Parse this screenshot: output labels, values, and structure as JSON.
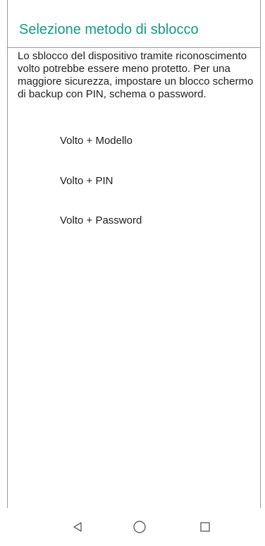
{
  "dialog": {
    "title": "Selezione metodo di sblocco",
    "description": "Lo sblocco del dispositivo tramite riconoscimento volto potrebbe essere meno protetto. Per una maggiore sicurezza, impostare un blocco schermo di backup con PIN, schema o password.",
    "options": [
      {
        "label": "Volto + Modello"
      },
      {
        "label": "Volto + PIN"
      },
      {
        "label": "Volto + Password"
      }
    ]
  },
  "navbar": {
    "icons": [
      "back-icon",
      "home-icon",
      "recents-icon"
    ],
    "icon_color": "#5f6368"
  },
  "colors": {
    "accent": "#149a8a",
    "text": "#1f1f1f",
    "divider": "#9a9a9a",
    "background": "#ffffff"
  }
}
